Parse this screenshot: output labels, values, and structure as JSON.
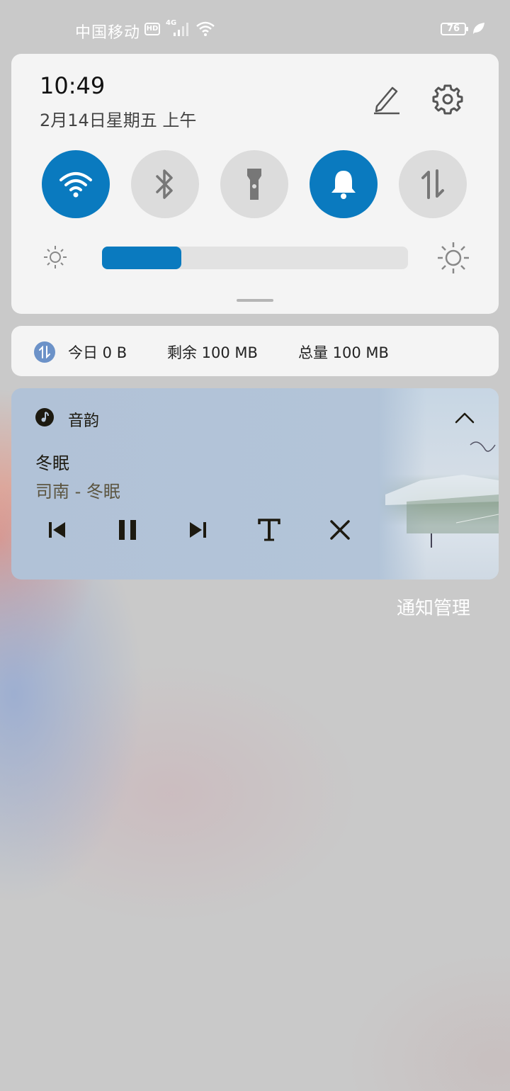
{
  "status_bar": {
    "carrier": "中国移动",
    "hd_badge": "HD",
    "network": "4G",
    "battery_level": "76",
    "icons": [
      "hd-icon",
      "signal-icon",
      "wifi-icon",
      "battery-icon",
      "leaf-icon"
    ]
  },
  "quick_panel": {
    "time": "10:49",
    "date": "2月14日星期五 上午",
    "toggles": [
      {
        "name": "wifi",
        "icon": "wifi-icon",
        "on": true
      },
      {
        "name": "bluetooth",
        "icon": "bluetooth-icon",
        "on": false
      },
      {
        "name": "flashlight",
        "icon": "flashlight-icon",
        "on": false
      },
      {
        "name": "sound",
        "icon": "bell-icon",
        "on": true
      },
      {
        "name": "mobile-data",
        "icon": "data-arrows-icon",
        "on": false
      }
    ],
    "brightness_fraction": 0.26,
    "accent_color": "#0a7abf"
  },
  "data_usage": {
    "today": "今日 0 B",
    "remaining": "剩余 100 MB",
    "total": "总量 100 MB"
  },
  "music": {
    "app_name": "音韵",
    "song": "冬眠",
    "subtitle": "司南 - 冬眠",
    "controls": [
      "previous-icon",
      "pause-icon",
      "next-icon",
      "lyrics-icon",
      "close-icon"
    ]
  },
  "notification_management": "通知管理"
}
